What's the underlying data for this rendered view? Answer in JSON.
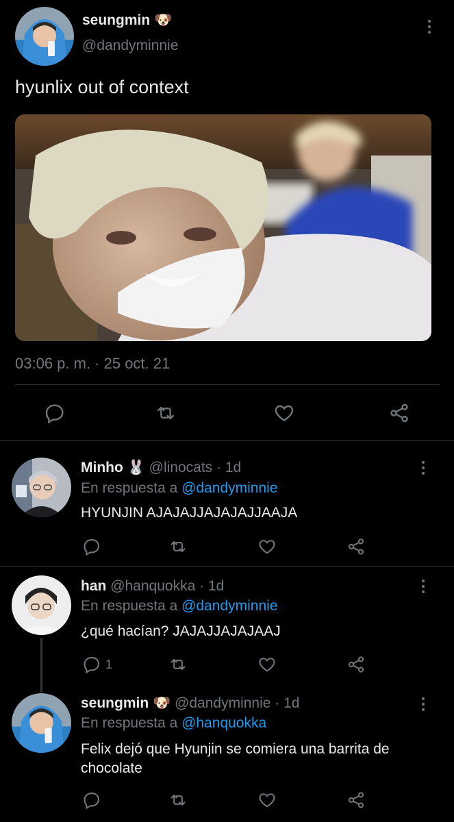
{
  "main_tweet": {
    "author_name": "seungmin",
    "author_emoji": "🐶",
    "handle": "@dandyminnie",
    "text": "hyunlix out of context",
    "timestamp": "03:06 p. m. · 25 oct. 21",
    "actions": [
      "reply-icon",
      "retweet-icon",
      "like-icon",
      "share-icon"
    ]
  },
  "replies": [
    {
      "author_name": "Minho",
      "author_emoji": "🐰",
      "handle": "@linocats",
      "time": "· 1d",
      "reply_prefix": "En respuesta a",
      "reply_to": "@dandyminnie",
      "text": "HYUNJIN AJAJAJJAJAJAJJAAJA",
      "reply_count": ""
    },
    {
      "author_name": "han",
      "author_emoji": "",
      "handle": "@hanquokka",
      "time": "· 1d",
      "reply_prefix": "En respuesta a",
      "reply_to": "@dandyminnie",
      "text": "¿qué hacían? JAJAJJAJAJAAJ",
      "reply_count": "1"
    },
    {
      "author_name": "seungmin",
      "author_emoji": "🐶",
      "handle": "@dandyminnie",
      "time": "· 1d",
      "reply_prefix": "En respuesta a",
      "reply_to": "@hanquokka",
      "text": "Felix dejó que Hyunjin se comiera una barrita de chocolate",
      "reply_count": ""
    }
  ],
  "colors": {
    "background": "#000000",
    "text": "#e7e9ea",
    "muted": "#71767b",
    "link": "#1d9bf0",
    "divider": "#2f3336"
  }
}
